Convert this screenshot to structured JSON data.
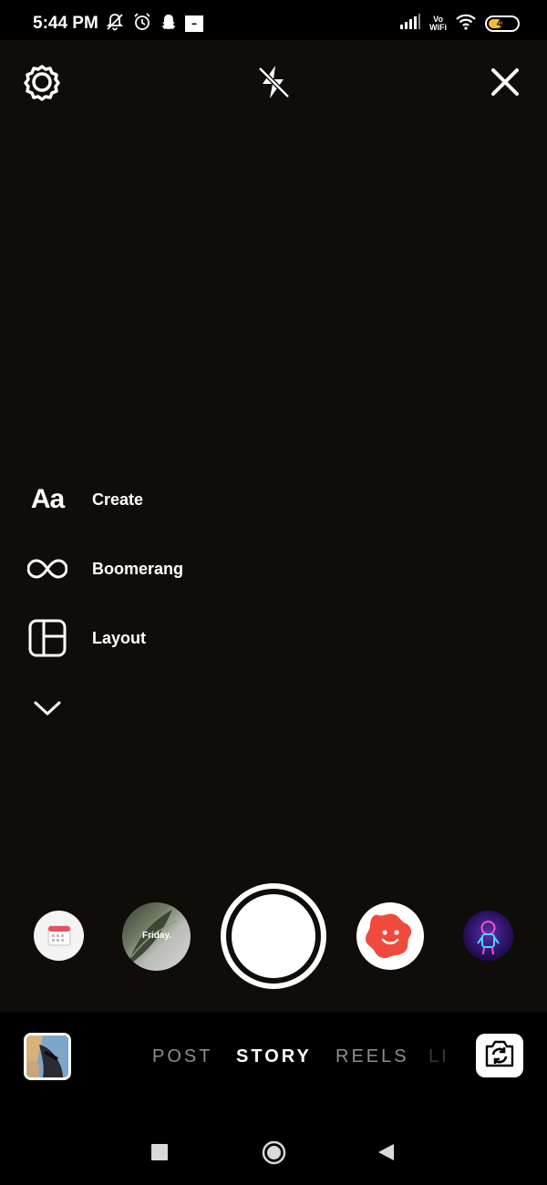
{
  "status_bar": {
    "time": "5:44 PM",
    "vowifi_top": "Vo",
    "vowifi_bottom": "WiFi",
    "battery_level": "47",
    "battery_color": "#f5b93a",
    "left_icons": [
      "mute-icon",
      "alarm-icon",
      "snapchat-icon",
      "app-badge-icon"
    ],
    "right_icons": [
      "signal-icon",
      "vowifi-icon",
      "wifi-icon",
      "battery-icon"
    ]
  },
  "top_controls": {
    "settings_icon": "gear-icon",
    "flash_icon": "flash-off-icon",
    "close_icon": "close-icon"
  },
  "mode_menu": {
    "create": {
      "icon_text": "Aa",
      "label": "Create"
    },
    "boomerang": {
      "icon": "infinity-icon",
      "label": "Boomerang"
    },
    "layout": {
      "icon": "layout-grid-icon",
      "label": "Layout"
    },
    "expand_icon": "chevron-down-icon"
  },
  "effects": {
    "friday_text": "Friday.",
    "items": [
      "calendar-effect",
      "friday-effect",
      "capture",
      "smiley-blob-effect",
      "astronaut-effect"
    ]
  },
  "capture_mode_tabs": [
    "POST",
    "STORY",
    "REELS",
    "LI"
  ],
  "active_tab": "STORY",
  "colors": {
    "background": "#000000",
    "viewfinder": "#0f0c0a",
    "inactive_tab": "#8e8e8e",
    "blob_red": "#ef4a3b"
  },
  "nav_bar": {
    "recents_icon": "square-icon",
    "home_icon": "circle-home-icon",
    "back_icon": "back-triangle-icon"
  }
}
